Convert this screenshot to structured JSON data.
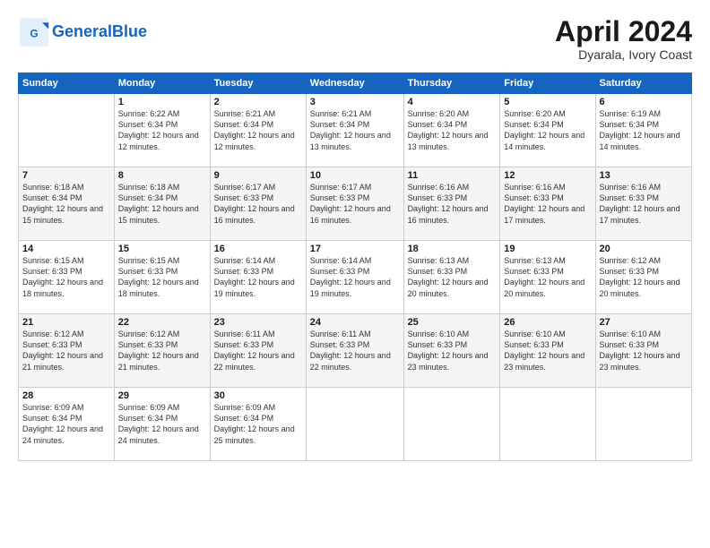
{
  "logo": {
    "text_general": "General",
    "text_blue": "Blue"
  },
  "header": {
    "month": "April 2024",
    "location": "Dyarala, Ivory Coast"
  },
  "weekdays": [
    "Sunday",
    "Monday",
    "Tuesday",
    "Wednesday",
    "Thursday",
    "Friday",
    "Saturday"
  ],
  "weeks": [
    [
      {
        "day": "",
        "sunrise": "",
        "sunset": "",
        "daylight": ""
      },
      {
        "day": "1",
        "sunrise": "Sunrise: 6:22 AM",
        "sunset": "Sunset: 6:34 PM",
        "daylight": "Daylight: 12 hours and 12 minutes."
      },
      {
        "day": "2",
        "sunrise": "Sunrise: 6:21 AM",
        "sunset": "Sunset: 6:34 PM",
        "daylight": "Daylight: 12 hours and 12 minutes."
      },
      {
        "day": "3",
        "sunrise": "Sunrise: 6:21 AM",
        "sunset": "Sunset: 6:34 PM",
        "daylight": "Daylight: 12 hours and 13 minutes."
      },
      {
        "day": "4",
        "sunrise": "Sunrise: 6:20 AM",
        "sunset": "Sunset: 6:34 PM",
        "daylight": "Daylight: 12 hours and 13 minutes."
      },
      {
        "day": "5",
        "sunrise": "Sunrise: 6:20 AM",
        "sunset": "Sunset: 6:34 PM",
        "daylight": "Daylight: 12 hours and 14 minutes."
      },
      {
        "day": "6",
        "sunrise": "Sunrise: 6:19 AM",
        "sunset": "Sunset: 6:34 PM",
        "daylight": "Daylight: 12 hours and 14 minutes."
      }
    ],
    [
      {
        "day": "7",
        "sunrise": "Sunrise: 6:18 AM",
        "sunset": "Sunset: 6:34 PM",
        "daylight": "Daylight: 12 hours and 15 minutes."
      },
      {
        "day": "8",
        "sunrise": "Sunrise: 6:18 AM",
        "sunset": "Sunset: 6:34 PM",
        "daylight": "Daylight: 12 hours and 15 minutes."
      },
      {
        "day": "9",
        "sunrise": "Sunrise: 6:17 AM",
        "sunset": "Sunset: 6:33 PM",
        "daylight": "Daylight: 12 hours and 16 minutes."
      },
      {
        "day": "10",
        "sunrise": "Sunrise: 6:17 AM",
        "sunset": "Sunset: 6:33 PM",
        "daylight": "Daylight: 12 hours and 16 minutes."
      },
      {
        "day": "11",
        "sunrise": "Sunrise: 6:16 AM",
        "sunset": "Sunset: 6:33 PM",
        "daylight": "Daylight: 12 hours and 16 minutes."
      },
      {
        "day": "12",
        "sunrise": "Sunrise: 6:16 AM",
        "sunset": "Sunset: 6:33 PM",
        "daylight": "Daylight: 12 hours and 17 minutes."
      },
      {
        "day": "13",
        "sunrise": "Sunrise: 6:16 AM",
        "sunset": "Sunset: 6:33 PM",
        "daylight": "Daylight: 12 hours and 17 minutes."
      }
    ],
    [
      {
        "day": "14",
        "sunrise": "Sunrise: 6:15 AM",
        "sunset": "Sunset: 6:33 PM",
        "daylight": "Daylight: 12 hours and 18 minutes."
      },
      {
        "day": "15",
        "sunrise": "Sunrise: 6:15 AM",
        "sunset": "Sunset: 6:33 PM",
        "daylight": "Daylight: 12 hours and 18 minutes."
      },
      {
        "day": "16",
        "sunrise": "Sunrise: 6:14 AM",
        "sunset": "Sunset: 6:33 PM",
        "daylight": "Daylight: 12 hours and 19 minutes."
      },
      {
        "day": "17",
        "sunrise": "Sunrise: 6:14 AM",
        "sunset": "Sunset: 6:33 PM",
        "daylight": "Daylight: 12 hours and 19 minutes."
      },
      {
        "day": "18",
        "sunrise": "Sunrise: 6:13 AM",
        "sunset": "Sunset: 6:33 PM",
        "daylight": "Daylight: 12 hours and 20 minutes."
      },
      {
        "day": "19",
        "sunrise": "Sunrise: 6:13 AM",
        "sunset": "Sunset: 6:33 PM",
        "daylight": "Daylight: 12 hours and 20 minutes."
      },
      {
        "day": "20",
        "sunrise": "Sunrise: 6:12 AM",
        "sunset": "Sunset: 6:33 PM",
        "daylight": "Daylight: 12 hours and 20 minutes."
      }
    ],
    [
      {
        "day": "21",
        "sunrise": "Sunrise: 6:12 AM",
        "sunset": "Sunset: 6:33 PM",
        "daylight": "Daylight: 12 hours and 21 minutes."
      },
      {
        "day": "22",
        "sunrise": "Sunrise: 6:12 AM",
        "sunset": "Sunset: 6:33 PM",
        "daylight": "Daylight: 12 hours and 21 minutes."
      },
      {
        "day": "23",
        "sunrise": "Sunrise: 6:11 AM",
        "sunset": "Sunset: 6:33 PM",
        "daylight": "Daylight: 12 hours and 22 minutes."
      },
      {
        "day": "24",
        "sunrise": "Sunrise: 6:11 AM",
        "sunset": "Sunset: 6:33 PM",
        "daylight": "Daylight: 12 hours and 22 minutes."
      },
      {
        "day": "25",
        "sunrise": "Sunrise: 6:10 AM",
        "sunset": "Sunset: 6:33 PM",
        "daylight": "Daylight: 12 hours and 23 minutes."
      },
      {
        "day": "26",
        "sunrise": "Sunrise: 6:10 AM",
        "sunset": "Sunset: 6:33 PM",
        "daylight": "Daylight: 12 hours and 23 minutes."
      },
      {
        "day": "27",
        "sunrise": "Sunrise: 6:10 AM",
        "sunset": "Sunset: 6:33 PM",
        "daylight": "Daylight: 12 hours and 23 minutes."
      }
    ],
    [
      {
        "day": "28",
        "sunrise": "Sunrise: 6:09 AM",
        "sunset": "Sunset: 6:34 PM",
        "daylight": "Daylight: 12 hours and 24 minutes."
      },
      {
        "day": "29",
        "sunrise": "Sunrise: 6:09 AM",
        "sunset": "Sunset: 6:34 PM",
        "daylight": "Daylight: 12 hours and 24 minutes."
      },
      {
        "day": "30",
        "sunrise": "Sunrise: 6:09 AM",
        "sunset": "Sunset: 6:34 PM",
        "daylight": "Daylight: 12 hours and 25 minutes."
      },
      {
        "day": "",
        "sunrise": "",
        "sunset": "",
        "daylight": ""
      },
      {
        "day": "",
        "sunrise": "",
        "sunset": "",
        "daylight": ""
      },
      {
        "day": "",
        "sunrise": "",
        "sunset": "",
        "daylight": ""
      },
      {
        "day": "",
        "sunrise": "",
        "sunset": "",
        "daylight": ""
      }
    ]
  ]
}
